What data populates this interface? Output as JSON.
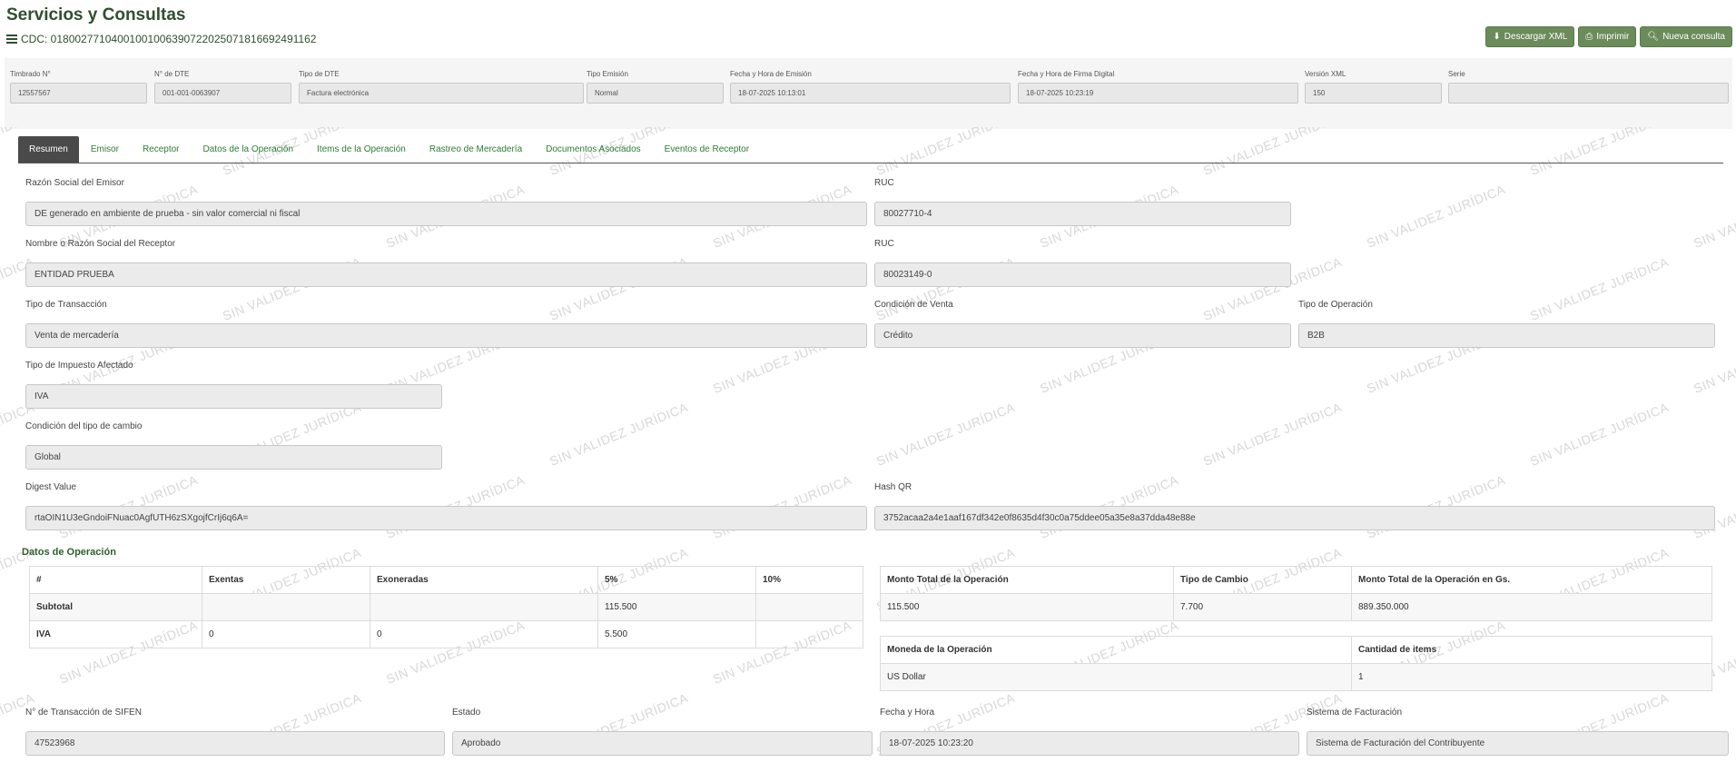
{
  "page": {
    "title": "Servicios y Consultas",
    "cdc_label": "CDC: 01800277104001001006390722025071816692491162"
  },
  "buttons": {
    "download_xml": "Descargar XML",
    "print": "Imprimir",
    "new_query": "Nueva consulta"
  },
  "header": [
    {
      "label": "Timbrado N°",
      "value": "12557567"
    },
    {
      "label": "N° de DTE",
      "value": "001-001-0063907"
    },
    {
      "label": "Tipo de DTE",
      "value": "Factura electrónica"
    },
    {
      "label": "Tipo Emisión",
      "value": "Normal"
    },
    {
      "label": "Fecha y Hora de Emisión",
      "value": "18-07-2025 10:13:01"
    },
    {
      "label": "Fecha y Hora de Firma Digital",
      "value": "18-07-2025 10:23:19"
    },
    {
      "label": "Versión XML",
      "value": "150"
    },
    {
      "label": "Serie",
      "value": ""
    }
  ],
  "tabs": [
    "Resumen",
    "Emisor",
    "Receptor",
    "Datos de la Operación",
    "Items de la Operación",
    "Rastreo de Mercadería",
    "Documentos Asociados",
    "Eventos de Receptor"
  ],
  "summary": {
    "razon_emisor": {
      "label": "Razón Social del Emisor",
      "value": "DE generado en ambiente de prueba - sin valor comercial ni fiscal"
    },
    "ruc_emisor": {
      "label": "RUC",
      "value": "80027710-4"
    },
    "nombre_receptor": {
      "label": "Nombre o Razón Social del Receptor",
      "value": "ENTIDAD PRUEBA"
    },
    "ruc_receptor": {
      "label": "RUC",
      "value": "80023149-0"
    },
    "tipo_transaccion": {
      "label": "Tipo de Transacción",
      "value": "Venta de mercadería"
    },
    "condicion_venta": {
      "label": "Condición de Venta",
      "value": "Crédito"
    },
    "tipo_operacion": {
      "label": "Tipo de Operación",
      "value": "B2B"
    },
    "tipo_impuesto": {
      "label": "Tipo de Impuesto Afectado",
      "value": "IVA"
    },
    "condicion_cambio": {
      "label": "Condición del tipo de cambio",
      "value": "Global"
    },
    "digest": {
      "label": "Digest Value",
      "value": "rtaOIN1U3eGndoiFNuac0AgfUTH6zSXgojfCrIj6q6A="
    },
    "hash_qr": {
      "label": "Hash QR",
      "value": "3752acaa2a4e1aaf167df342e0f8635d4f30c0a75ddee05a35e8a37dda48e88e"
    }
  },
  "operacion": {
    "section_title": "Datos de Operación",
    "tax_table": {
      "headers": [
        "#",
        "Exentas",
        "Exoneradas",
        "5%",
        "10%"
      ],
      "rows": [
        [
          "Subtotal",
          "",
          "",
          "115.500",
          ""
        ],
        [
          "IVA",
          "0",
          "0",
          "5.500",
          ""
        ]
      ]
    },
    "totals_table": {
      "headers": [
        "Monto Total de la Operación",
        "Tipo de Cambio",
        "Monto Total de la Operación en Gs."
      ],
      "row": [
        "115.500",
        "7.700",
        "889.350.000"
      ]
    },
    "currency_table": {
      "headers": [
        "Moneda de la Operación",
        "Cantidad de items"
      ],
      "row": [
        "US Dollar",
        "1"
      ]
    }
  },
  "footer_fields": {
    "transaccion": {
      "label": "N° de Transacción de SIFEN",
      "value": "47523968"
    },
    "estado": {
      "label": "Estado",
      "value": "Aprobado"
    },
    "fecha_hora": {
      "label": "Fecha y Hora",
      "value": "18-07-2025 10:23:20"
    },
    "sistema": {
      "label": "Sistema de Facturación",
      "value": "Sistema de Facturación del Contribuyente"
    }
  },
  "watermark_text": "SIN VALIDEZ JURÍDICA"
}
